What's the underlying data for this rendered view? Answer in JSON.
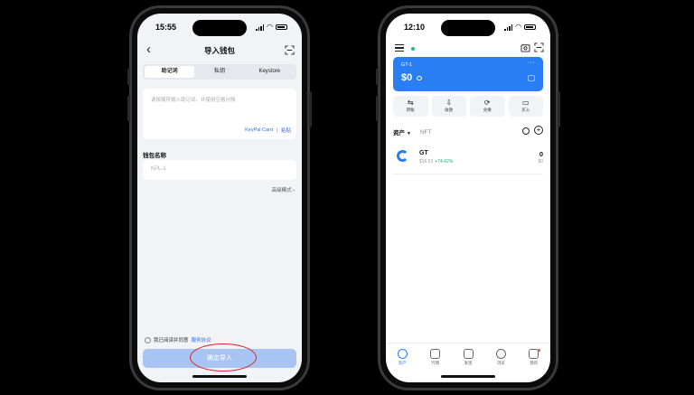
{
  "left_phone": {
    "status": {
      "time": "15:55"
    },
    "header": {
      "title": "导入钱包"
    },
    "tabs": [
      {
        "label": "助记词",
        "active": true
      },
      {
        "label": "私钥",
        "active": false
      },
      {
        "label": "Keystore",
        "active": false
      }
    ],
    "mnemonic": {
      "placeholder": "请按顺序输入助记词，并使用空格分隔",
      "keypal_link": "KeyPal Card",
      "paste_link": "粘贴"
    },
    "wallet_name": {
      "label": "钱包名称",
      "value": "KPL-1"
    },
    "advanced_mode": "高级模式 ›",
    "agreement": {
      "text": "我已阅读并同意",
      "link": "服务协议"
    },
    "confirm_button": "确定导入",
    "highlight_color": "#d9242b"
  },
  "right_phone": {
    "status": {
      "time": "12:10"
    },
    "wallet_card": {
      "wallet_name": "GT-1",
      "balance": "$0",
      "more": "···",
      "color": "#2a7ef5"
    },
    "actions": [
      {
        "icon": "transfer-icon",
        "glyph": "⇆",
        "label": "转账"
      },
      {
        "icon": "receive-icon",
        "glyph": "⇩",
        "label": "收款"
      },
      {
        "icon": "swap-icon",
        "glyph": "⟳",
        "label": "兑换"
      },
      {
        "icon": "buy-icon",
        "glyph": "▭",
        "label": "买入"
      }
    ],
    "asset_tabs": [
      {
        "label": "资产",
        "active": true,
        "caret": "▼"
      },
      {
        "label": "NFT",
        "active": false
      }
    ],
    "tokens": [
      {
        "symbol": "GT",
        "price": "$16.53",
        "change": "+74.42%",
        "amount": "0",
        "value": "$0"
      }
    ],
    "bottom_nav": [
      {
        "label": "资产",
        "active": true
      },
      {
        "label": "行情",
        "active": false
      },
      {
        "label": "发现",
        "active": false
      },
      {
        "label": "浏览",
        "active": false
      },
      {
        "label": "我的",
        "active": false,
        "badge": true
      }
    ]
  }
}
